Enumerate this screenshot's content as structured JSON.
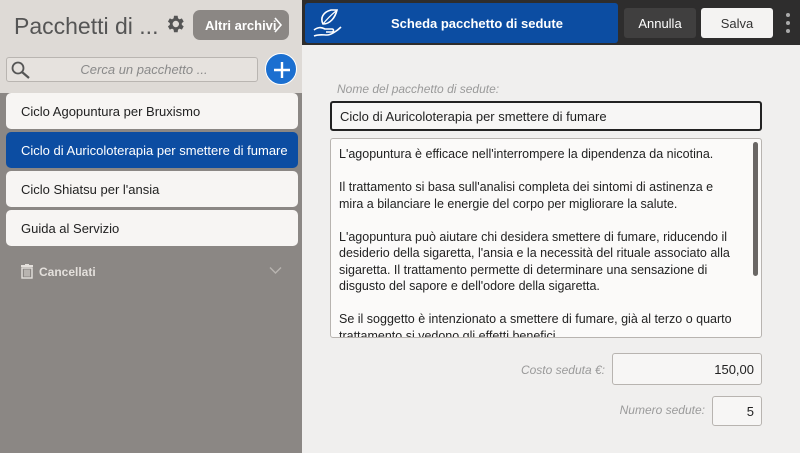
{
  "sidebar": {
    "title": "Pacchetti di ...",
    "archive_button": "Altri archivi",
    "search_placeholder": "Cerca un pacchetto ...",
    "packages": [
      {
        "label": "Ciclo Agopuntura per Bruxismo",
        "selected": false
      },
      {
        "label": "Ciclo di Auricoloterapia per smettere di fumare",
        "selected": true
      },
      {
        "label": "Ciclo Shiatsu per l'ansia",
        "selected": false
      },
      {
        "label": "Guida al Servizio",
        "selected": false
      }
    ],
    "deleted_label": "Cancellati"
  },
  "header": {
    "title": "Scheda pacchetto di sedute",
    "cancel_label": "Annulla",
    "save_label": "Salva"
  },
  "form": {
    "name_label": "Nome del pacchetto di sedute:",
    "name_value": "Ciclo di Auricoloterapia per smettere di fumare",
    "description": [
      "L'agopuntura è efficace nell'interrompere la dipendenza da nicotina.",
      "Il trattamento si basa sull'analisi completa dei sintomi di astinenza e mira a bilanciare le energie del corpo per migliorare la salute.",
      "L'agopuntura può aiutare chi desidera smettere di fumare, riducendo il desiderio della sigaretta, l'ansia e la necessità del rituale associato alla sigaretta. Il trattamento permette di determinare una sensazione di disgusto del sapore e dell'odore della sigaretta.",
      "Se il soggetto è intenzionato a smettere di fumare, già al terzo o quarto trattamento si vedono gli effetti benefici."
    ],
    "cost_label": "Costo seduta €:",
    "cost_value": "150,00",
    "sessions_label": "Numero sedute:",
    "sessions_value": "5"
  },
  "colors": {
    "accent_blue": "#0c4da2",
    "plus_button": "#1b6fd0",
    "topbar": "#2e2d2d",
    "sidebar_bg": "#8b8784"
  },
  "icons": [
    "gear-icon",
    "chevron-right-icon",
    "search-icon",
    "plus-icon",
    "trash-icon",
    "chevron-down-icon",
    "leaf-hand-icon",
    "more-vertical-icon"
  ]
}
